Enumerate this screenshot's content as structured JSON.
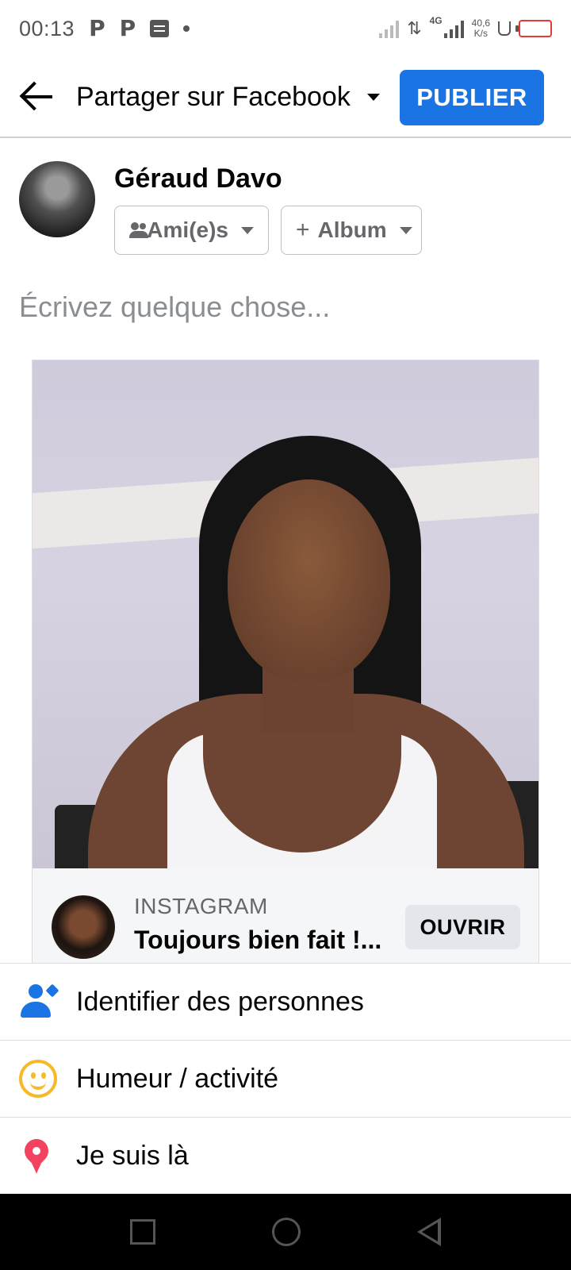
{
  "status_bar": {
    "time": "00:13",
    "notif_p1": "P",
    "notif_p2": "P",
    "network": "4G",
    "speed_value": "40,6",
    "speed_unit": "K/s",
    "battery_color": "#e53935"
  },
  "header": {
    "title": "Partager sur Facebook",
    "publish_label": "PUBLIER",
    "accent": "#1b74e4"
  },
  "author": {
    "name": "Géraud Davo",
    "audience_label": "Ami(e)s",
    "album_label": "Album"
  },
  "composer": {
    "placeholder": "Écrivez quelque chose..."
  },
  "shared_post": {
    "source_label": "INSTAGRAM",
    "title": "Toujours bien fait !...",
    "open_label": "OUVRIR"
  },
  "actions": [
    {
      "label": "Identifier des personnes",
      "icon": "tag-people-icon"
    },
    {
      "label": "Humeur / activité",
      "icon": "smile-icon"
    },
    {
      "label": "Je suis là",
      "icon": "location-pin-icon"
    }
  ],
  "nav": {
    "recents_icon": "square-icon",
    "home_icon": "circle-icon",
    "back_icon": "triangle-back-icon"
  }
}
